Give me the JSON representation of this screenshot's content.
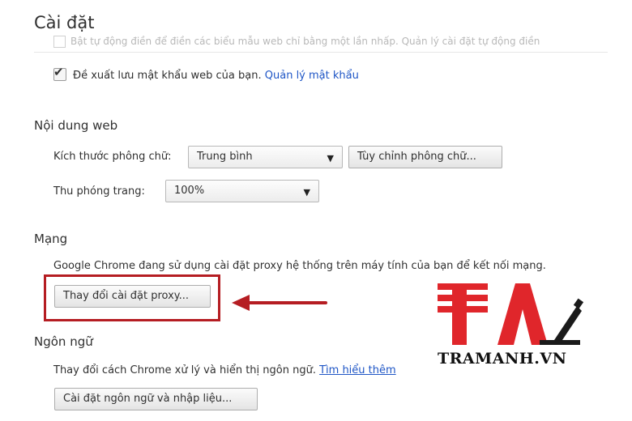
{
  "page": {
    "title": "Cài đặt"
  },
  "partial_row": {
    "text": "Bật tự động điền để điền các biểu mẫu web chỉ bằng một lần nhấp. Quản lý cài đặt tự động điền"
  },
  "passwords": {
    "checked": true,
    "label": "Đề xuất lưu mật khẩu web của bạn.",
    "manage_link": "Quản lý mật khẩu"
  },
  "web_content": {
    "heading": "Nội dung web",
    "font_size_label": "Kích thước phông chữ:",
    "font_size_value": "Trung bình",
    "customize_fonts_button": "Tùy chỉnh phông chữ...",
    "zoom_label": "Thu phóng trang:",
    "zoom_value": "100%"
  },
  "network": {
    "heading": "Mạng",
    "description": "Google Chrome đang sử dụng cài đặt proxy hệ thống trên máy tính của bạn để kết nối mạng.",
    "change_proxy_button": "Thay đổi cài đặt proxy..."
  },
  "languages": {
    "heading": "Ngôn ngữ",
    "description": "Thay đổi cách Chrome xử lý và hiển thị ngôn ngữ.",
    "learn_more_link": "Tìm hiểu thêm",
    "settings_button": "Cài đặt ngôn ngữ và nhập liệu..."
  },
  "watermark": {
    "text": "TRAMANH.VN"
  },
  "icons": {
    "dropdown": "▼",
    "check": "✔"
  },
  "colors": {
    "link": "#1f56c6",
    "highlight": "#b51d22",
    "logo_red": "#e0262b",
    "text": "#303030"
  }
}
